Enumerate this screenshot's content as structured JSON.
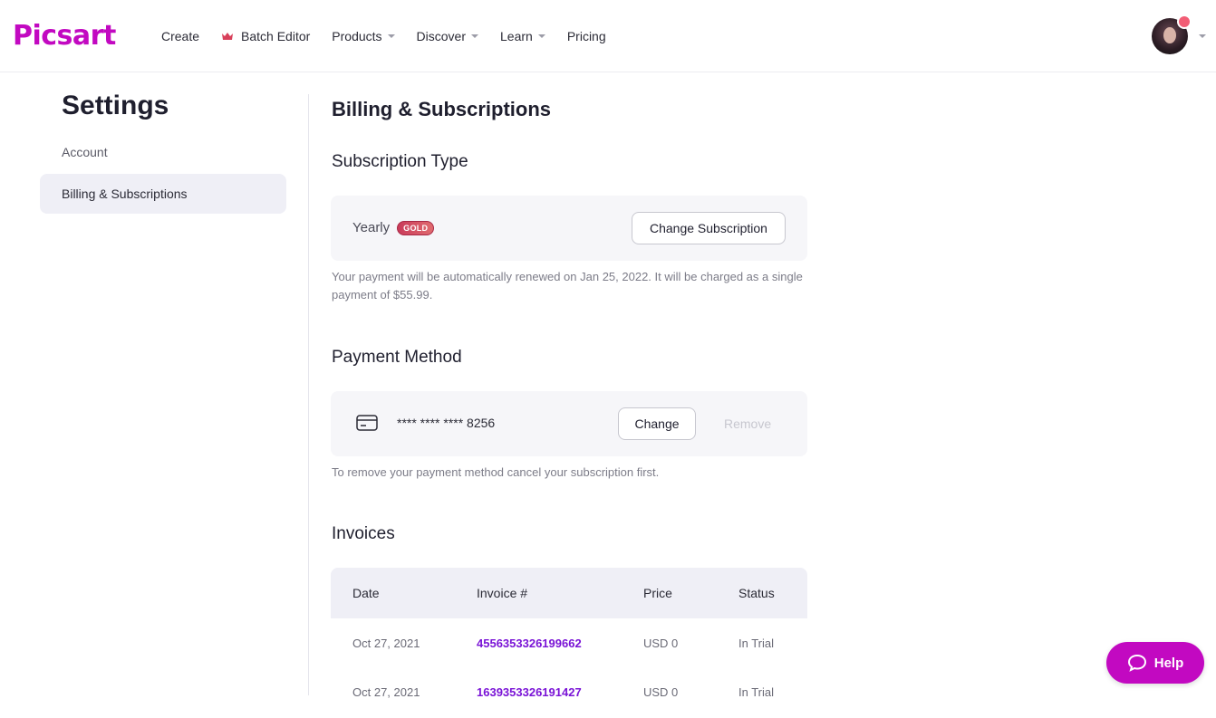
{
  "brand": {
    "logo_text": "Picsart",
    "accent": "#c209c1"
  },
  "nav": {
    "items": [
      {
        "label": "Create",
        "has_dropdown": false,
        "icon": null
      },
      {
        "label": "Batch Editor",
        "has_dropdown": false,
        "icon": "crown-icon"
      },
      {
        "label": "Products",
        "has_dropdown": true,
        "icon": null
      },
      {
        "label": "Discover",
        "has_dropdown": true,
        "icon": null
      },
      {
        "label": "Learn",
        "has_dropdown": true,
        "icon": null
      },
      {
        "label": "Pricing",
        "has_dropdown": false,
        "icon": null
      }
    ]
  },
  "sidebar": {
    "title": "Settings",
    "items": [
      {
        "label": "Account",
        "active": false
      },
      {
        "label": "Billing & Subscriptions",
        "active": true
      }
    ]
  },
  "main": {
    "title": "Billing & Subscriptions",
    "subscription": {
      "heading": "Subscription Type",
      "plan": "Yearly",
      "badge": "GOLD",
      "change_button": "Change Subscription",
      "note": "Your payment will be automatically renewed on Jan 25, 2022. It will be charged as a single payment of $55.99."
    },
    "payment": {
      "heading": "Payment Method",
      "card_number": "**** **** **** 8256",
      "change_button": "Change",
      "remove_button": "Remove",
      "note": "To remove your payment method cancel your subscription first."
    },
    "invoices": {
      "heading": "Invoices",
      "columns": [
        "Date",
        "Invoice #",
        "Price",
        "Status"
      ],
      "rows": [
        {
          "date": "Oct 27, 2021",
          "invoice": "4556353326199662",
          "price": "USD 0",
          "status": "In Trial"
        },
        {
          "date": "Oct 27, 2021",
          "invoice": "1639353326191427",
          "price": "USD 0",
          "status": "In Trial"
        }
      ]
    }
  },
  "help": {
    "label": "Help"
  }
}
